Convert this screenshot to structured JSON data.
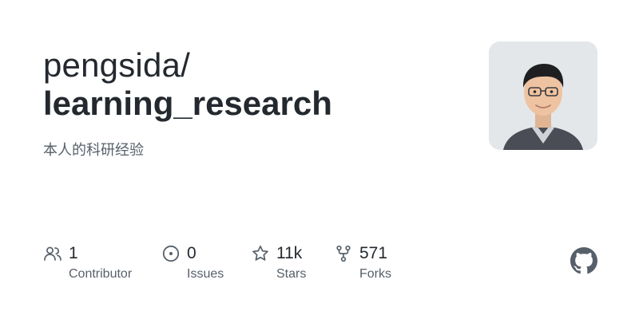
{
  "repo": {
    "owner": "pengsida/",
    "name": "learning_research",
    "description": "本人的科研经验"
  },
  "avatar": {
    "icon": "user-avatar-photo"
  },
  "stats": {
    "contributors": {
      "value": "1",
      "label": "Contributor",
      "icon": "people-icon"
    },
    "issues": {
      "value": "0",
      "label": "Issues",
      "icon": "issue-opened-icon"
    },
    "stars": {
      "value": "11k",
      "label": "Stars",
      "icon": "star-icon"
    },
    "forks": {
      "value": "571",
      "label": "Forks",
      "icon": "repo-forked-icon"
    }
  },
  "brand": {
    "logo_icon": "github-logo-icon",
    "text_color": "#24292f",
    "muted_color": "#57606a",
    "icon_color": "#57606a"
  }
}
